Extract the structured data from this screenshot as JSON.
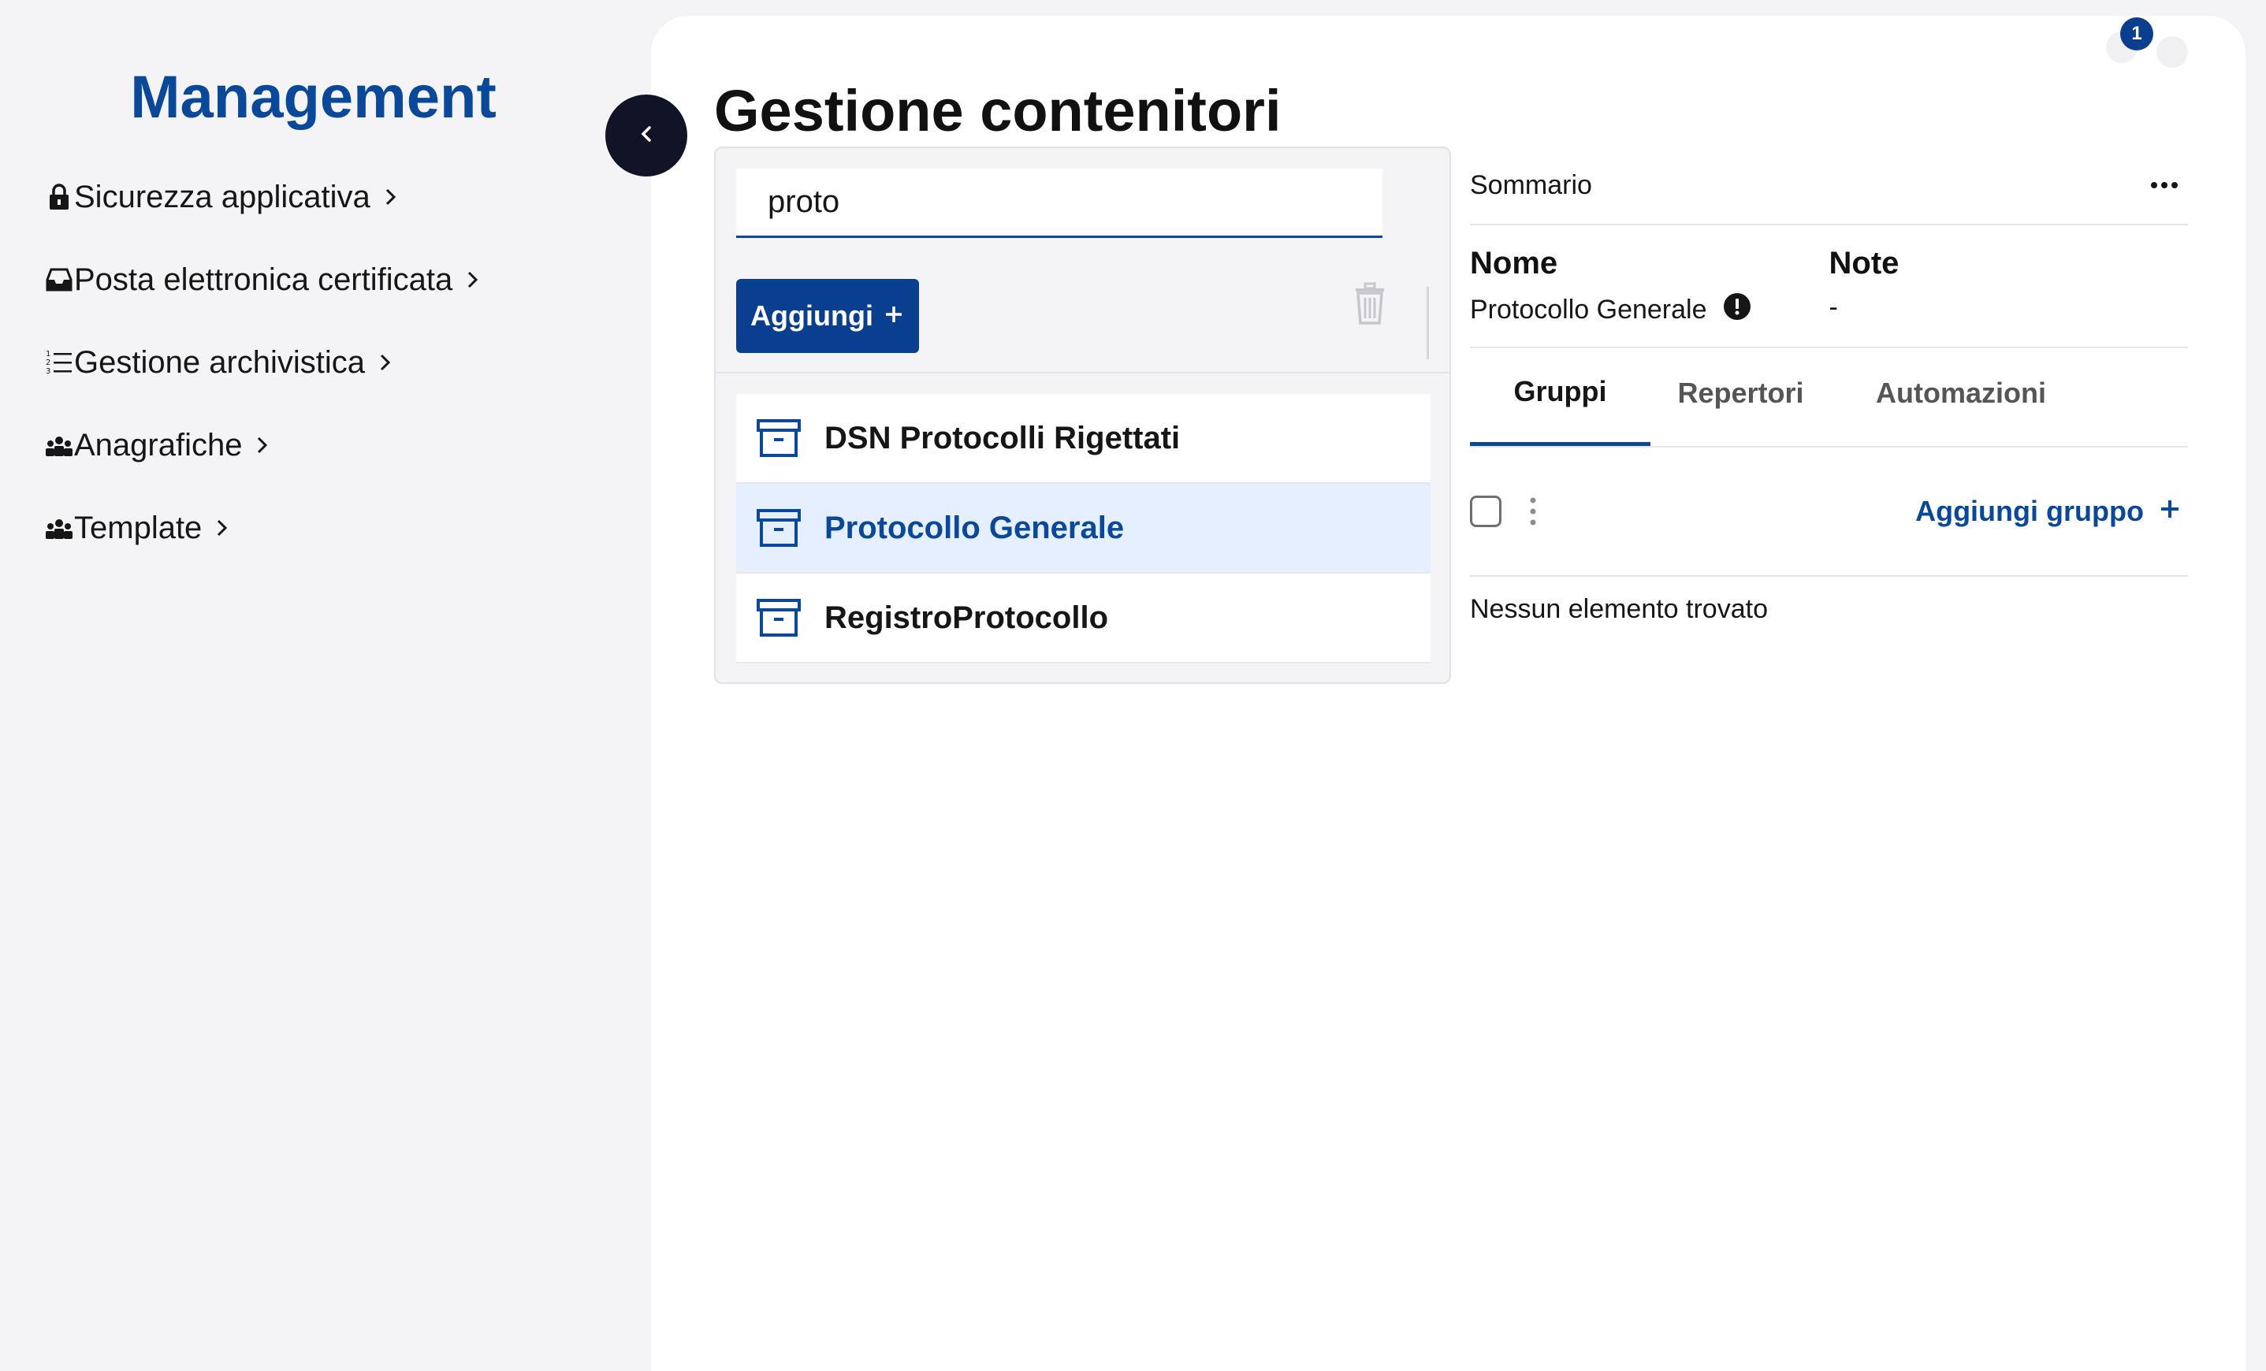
{
  "sidebar": {
    "title": "Management",
    "items": [
      {
        "label": "Sicurezza applicativa",
        "icon": "lock-icon"
      },
      {
        "label": "Posta elettronica certificata",
        "icon": "inbox-icon"
      },
      {
        "label": "Gestione archivistica",
        "icon": "numbered-list-icon"
      },
      {
        "label": "Anagrafiche",
        "icon": "users-icon"
      },
      {
        "label": "Template",
        "icon": "users-icon"
      }
    ]
  },
  "header": {
    "title": "Gestione contenitori",
    "notification_count": "1"
  },
  "containers": {
    "search_value": "proto",
    "add_label": "Aggiungi",
    "items": [
      {
        "label": "DSN Protocolli Rigettati",
        "selected": false
      },
      {
        "label": "Protocollo Generale",
        "selected": true
      },
      {
        "label": "RegistroProtocollo",
        "selected": false
      }
    ]
  },
  "summary": {
    "label": "Sommario",
    "name_label": "Nome",
    "name_value": "Protocollo Generale",
    "note_label": "Note",
    "note_value": "-",
    "tabs": [
      {
        "label": "Gruppi",
        "active": true
      },
      {
        "label": "Repertori",
        "active": false
      },
      {
        "label": "Automazioni",
        "active": false
      }
    ],
    "add_group_label": "Aggiungi gruppo",
    "empty_message": "Nessun elemento trovato"
  },
  "colors": {
    "accent": "#0a4899",
    "primary_button": "#0a3f8f",
    "selected_row": "#e5efff"
  }
}
